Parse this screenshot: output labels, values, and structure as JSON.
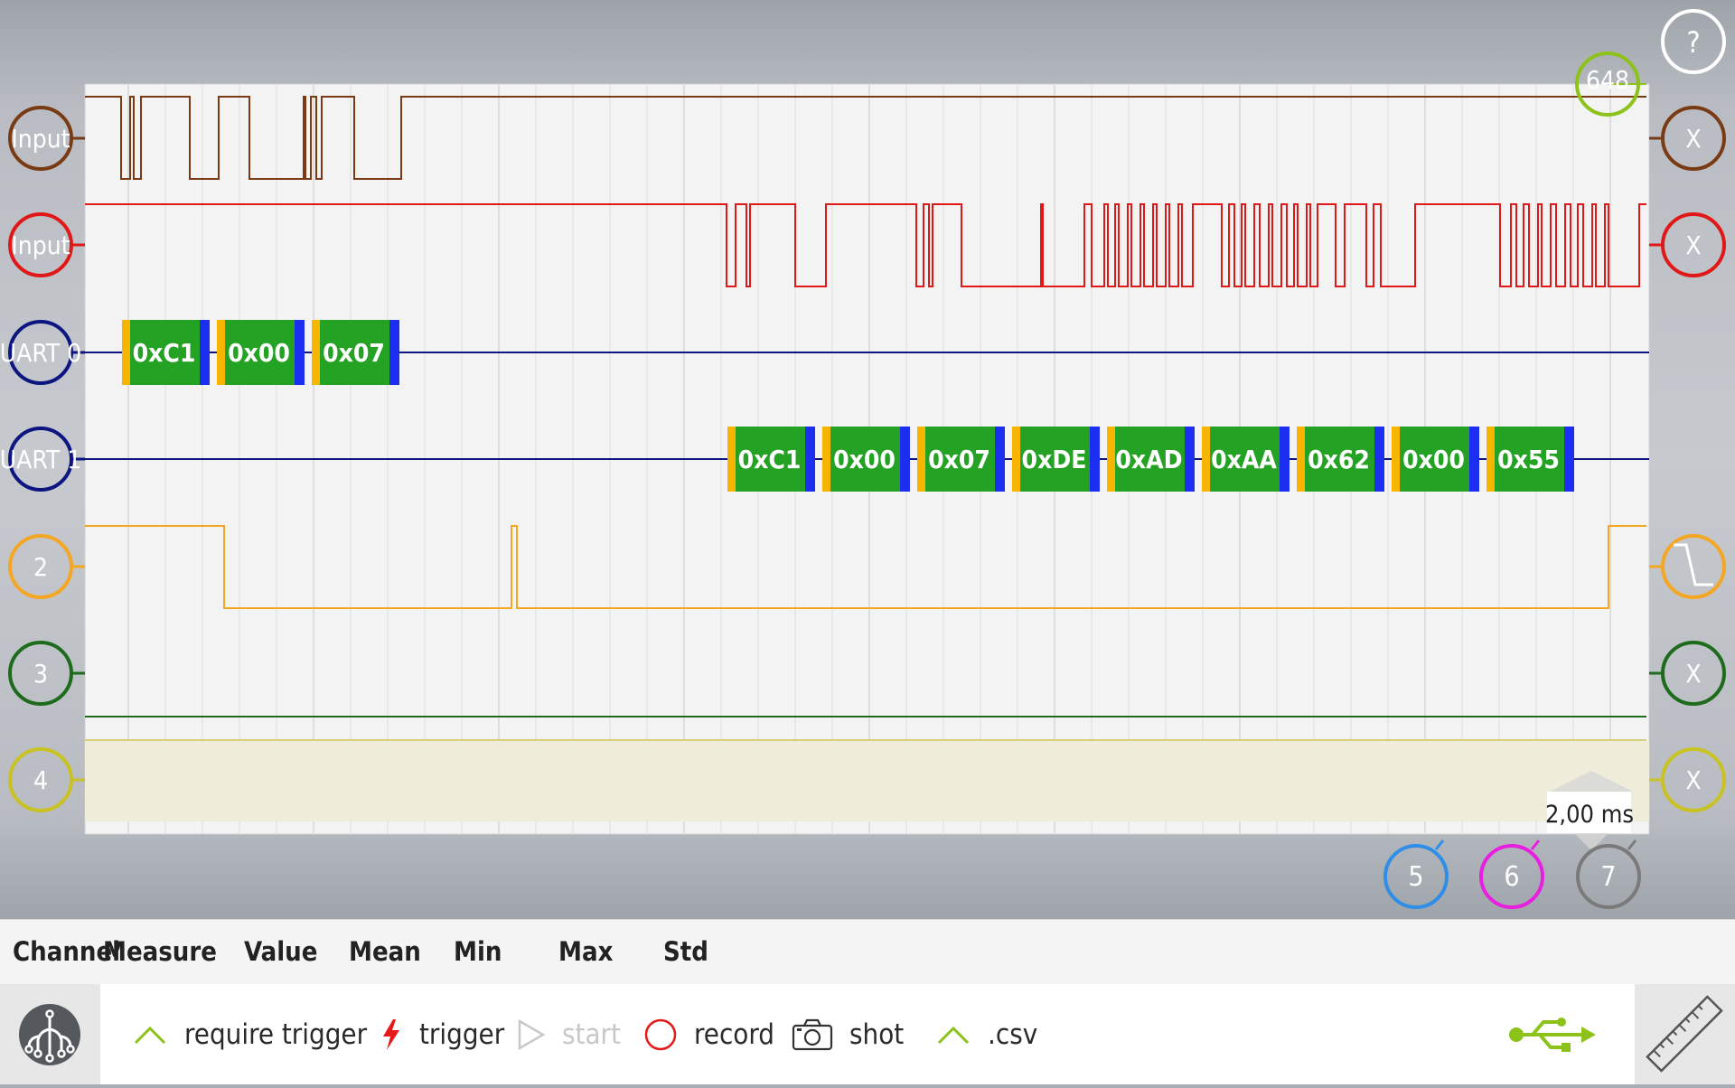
{
  "channels_left": [
    {
      "label": "Input",
      "color": "#7a3b14"
    },
    {
      "label": "Input",
      "color": "#e01818"
    },
    {
      "label": "UART 0",
      "color": "#0d1580"
    },
    {
      "label": "UART 1",
      "color": "#0d1580"
    },
    {
      "label": "2",
      "color": "#f5a623"
    },
    {
      "label": "3",
      "color": "#1e6b1e"
    },
    {
      "label": "4",
      "color": "#c8c223"
    }
  ],
  "channels_right": [
    {
      "label": "X",
      "color": "#7a3b14"
    },
    {
      "label": "X",
      "color": "#e01818"
    },
    {
      "label": "",
      "color": "#f5a623"
    },
    {
      "label": "X",
      "color": "#1e6b1e"
    },
    {
      "label": "X",
      "color": "#c8c223"
    }
  ],
  "help_label": "?",
  "trigger_marker": {
    "value": "648",
    "color": "#8cc21a"
  },
  "timebase_label": "2,00 ms",
  "extra_channels": [
    {
      "label": "5",
      "color": "#2f8fe8"
    },
    {
      "label": "6",
      "color": "#e81ee0"
    },
    {
      "label": "7",
      "color": "#7a7a7a"
    }
  ],
  "uart0_bytes": [
    "0xC1",
    "0x00",
    "0x07"
  ],
  "uart1_bytes": [
    "0xC1",
    "0x00",
    "0x07",
    "0xDE",
    "0xAD",
    "0xAA",
    "0x62",
    "0x00",
    "0x55"
  ],
  "measure_headers": [
    "Channel",
    "Measure",
    "Value",
    "Mean",
    "Min",
    "Max",
    "Std"
  ],
  "toolbar": {
    "require_trigger": "require trigger",
    "trigger": "trigger",
    "start": "start",
    "record": "record",
    "shot": "shot",
    "csv": ".csv"
  },
  "colors": {
    "accent_green": "#8cc21a",
    "byte_green": "#24a224",
    "byte_yellow": "#f7b500",
    "byte_blue": "#1c2ef0",
    "grid_bg": "#f3f3f3"
  }
}
